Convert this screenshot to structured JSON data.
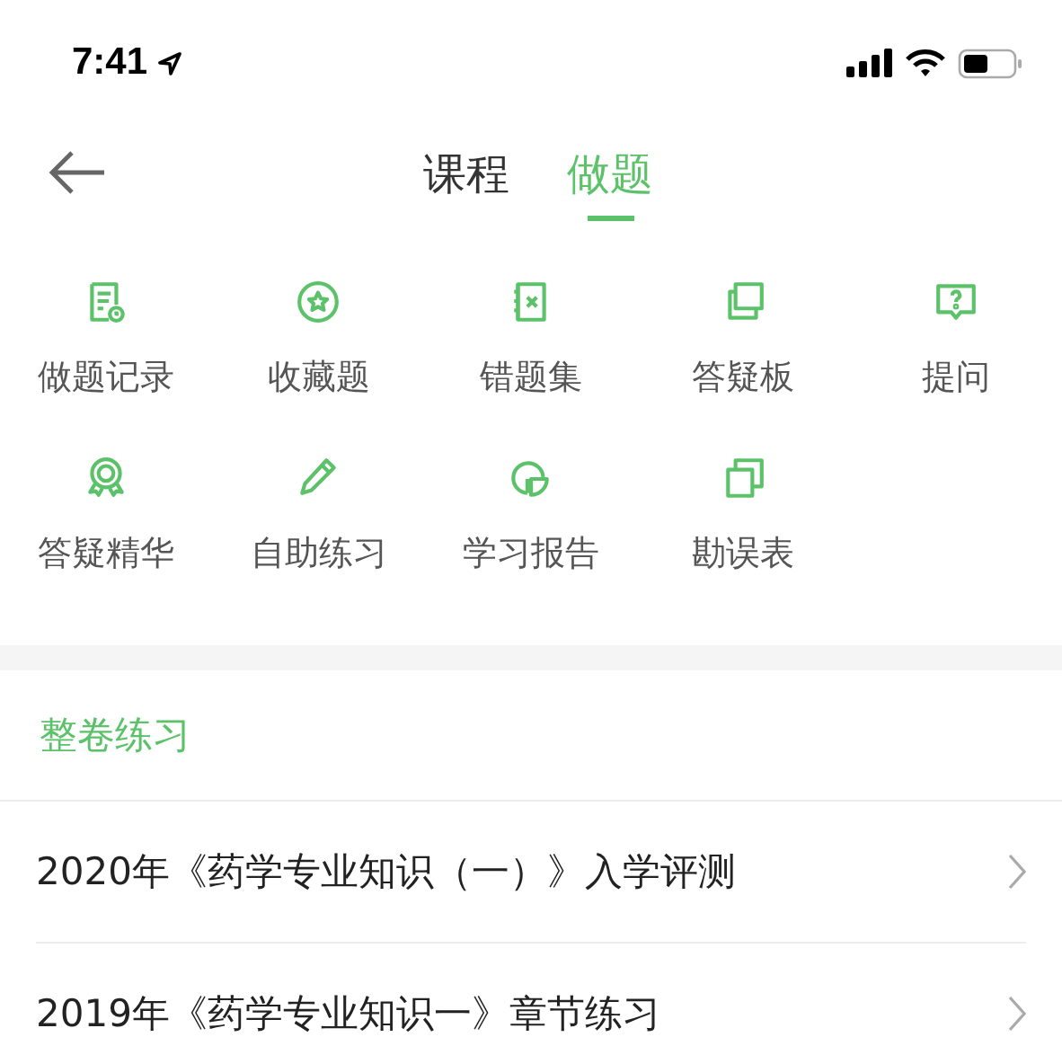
{
  "status_bar": {
    "time": "7:41"
  },
  "nav": {
    "tabs": [
      {
        "label": "课程",
        "selected": false
      },
      {
        "label": "做题",
        "selected": true
      }
    ]
  },
  "tools": [
    {
      "label": "做题记录",
      "kind": "record"
    },
    {
      "label": "收藏题",
      "kind": "favorite"
    },
    {
      "label": "错题集",
      "kind": "mistakes"
    },
    {
      "label": "答疑板",
      "kind": "board"
    },
    {
      "label": "提问",
      "kind": "question"
    },
    {
      "label": "答疑精华",
      "kind": "award"
    },
    {
      "label": "自助练习",
      "kind": "pencil"
    },
    {
      "label": "学习报告",
      "kind": "report"
    },
    {
      "label": "勘误表",
      "kind": "copies"
    }
  ],
  "section": {
    "title": "整卷练习",
    "items": [
      {
        "label": "2020年《药学专业知识（一）》入学评测"
      },
      {
        "label": "2019年《药学专业知识一》章节练习"
      }
    ]
  }
}
